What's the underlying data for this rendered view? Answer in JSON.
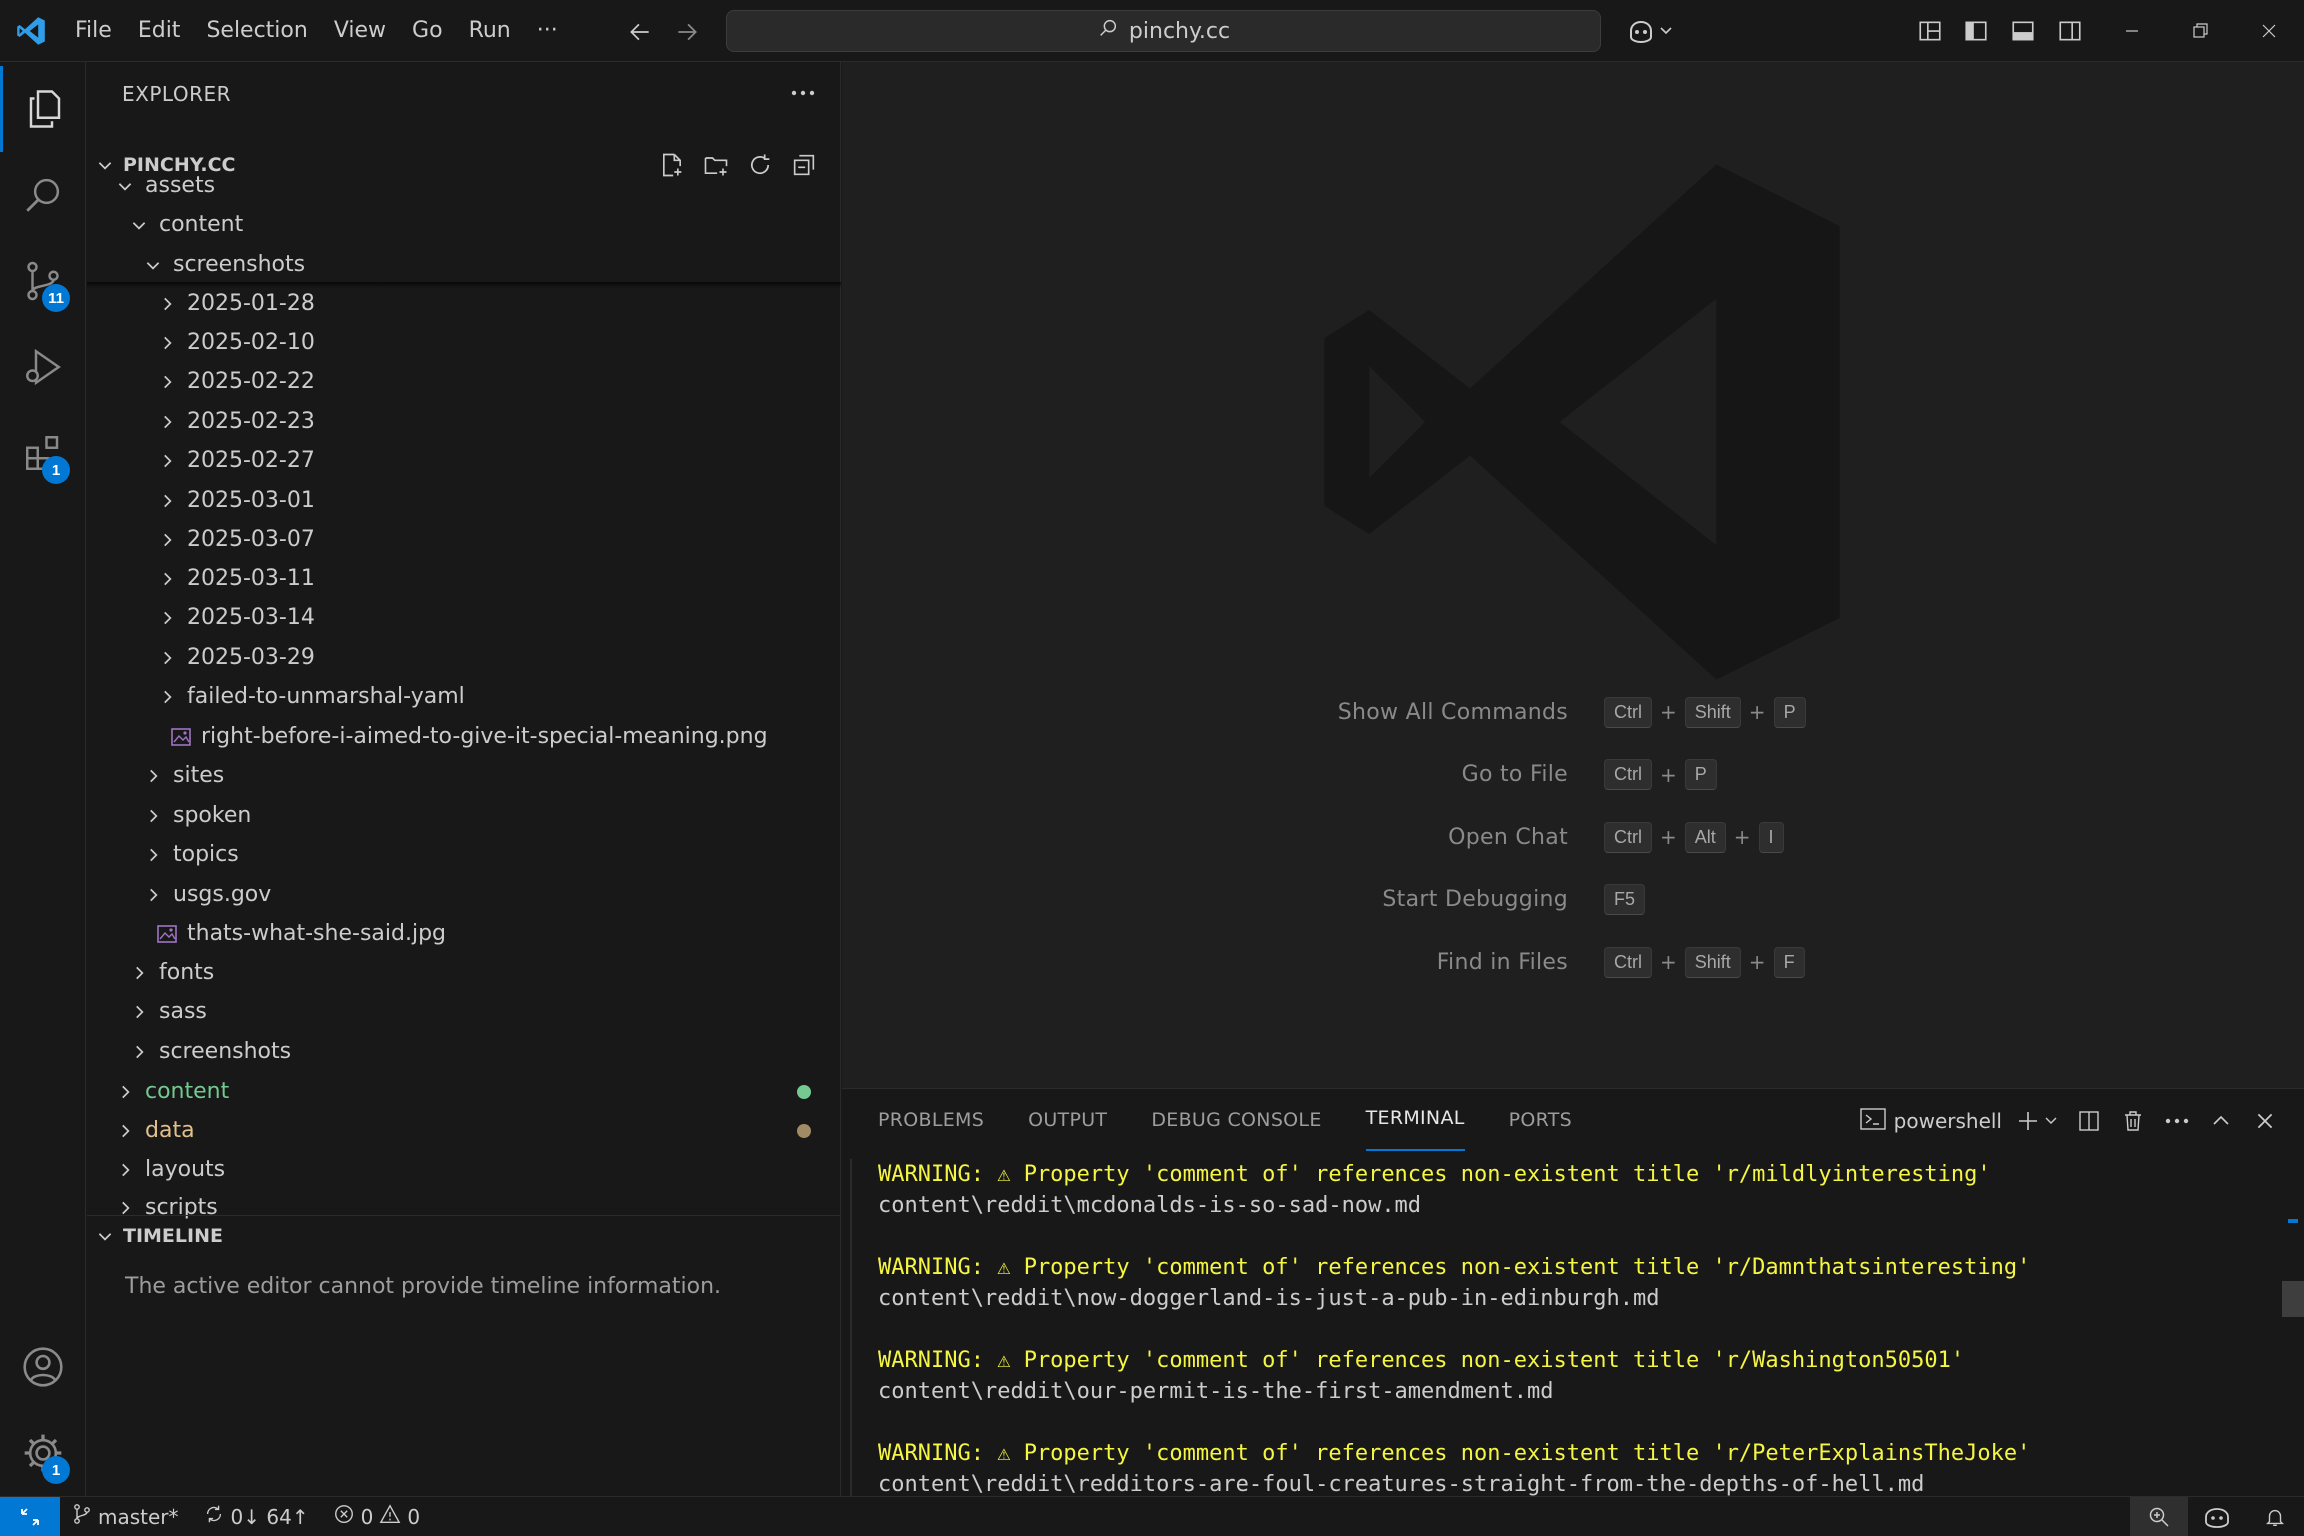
{
  "titlebar": {
    "menu": [
      "File",
      "Edit",
      "Selection",
      "View",
      "Go",
      "Run",
      "···"
    ],
    "search_text": "pinchy.cc"
  },
  "activity": {
    "scm_badge": "11",
    "extensions_badge": "1",
    "settings_badge": "1"
  },
  "explorer": {
    "title": "EXPLORER",
    "root": "PINCHY.CC",
    "rows": [
      {
        "label": "assets",
        "type": "folder-open",
        "depth": 1
      },
      {
        "label": "content",
        "type": "folder-open",
        "depth": 2
      },
      {
        "label": "screenshots",
        "type": "folder-open",
        "depth": 3
      },
      {
        "label": "2025-01-28",
        "type": "folder",
        "depth": 4
      },
      {
        "label": "2025-02-10",
        "type": "folder",
        "depth": 4
      },
      {
        "label": "2025-02-22",
        "type": "folder",
        "depth": 4
      },
      {
        "label": "2025-02-23",
        "type": "folder",
        "depth": 4
      },
      {
        "label": "2025-02-27",
        "type": "folder",
        "depth": 4
      },
      {
        "label": "2025-03-01",
        "type": "folder",
        "depth": 4
      },
      {
        "label": "2025-03-07",
        "type": "folder",
        "depth": 4
      },
      {
        "label": "2025-03-11",
        "type": "folder",
        "depth": 4
      },
      {
        "label": "2025-03-14",
        "type": "folder",
        "depth": 4
      },
      {
        "label": "2025-03-29",
        "type": "folder",
        "depth": 4
      },
      {
        "label": "failed-to-unmarshal-yaml",
        "type": "folder",
        "depth": 4
      },
      {
        "label": "right-before-i-aimed-to-give-it-special-meaning.png",
        "type": "image",
        "depth": 4
      },
      {
        "label": "sites",
        "type": "folder",
        "depth": 3
      },
      {
        "label": "spoken",
        "type": "folder",
        "depth": 3
      },
      {
        "label": "topics",
        "type": "folder",
        "depth": 3
      },
      {
        "label": "usgs.gov",
        "type": "folder",
        "depth": 3
      },
      {
        "label": "thats-what-she-said.jpg",
        "type": "image",
        "depth": 3
      },
      {
        "label": "fonts",
        "type": "folder",
        "depth": 2
      },
      {
        "label": "sass",
        "type": "folder",
        "depth": 2
      },
      {
        "label": "screenshots",
        "type": "folder",
        "depth": 2
      },
      {
        "label": "content",
        "type": "folder",
        "depth": 1,
        "color": "#73c991",
        "dot": "#73c991"
      },
      {
        "label": "data",
        "type": "folder",
        "depth": 1,
        "color": "#e2c08d",
        "dot": "#a28a64"
      },
      {
        "label": "layouts",
        "type": "folder",
        "depth": 1
      },
      {
        "label": "scripts",
        "type": "folder",
        "depth": 1
      }
    ]
  },
  "timeline": {
    "title": "TIMELINE",
    "message": "The active editor cannot provide timeline information."
  },
  "shortcuts": [
    {
      "label": "Show All Commands",
      "keys": [
        "Ctrl",
        "Shift",
        "P"
      ]
    },
    {
      "label": "Go to File",
      "keys": [
        "Ctrl",
        "P"
      ]
    },
    {
      "label": "Open Chat",
      "keys": [
        "Ctrl",
        "Alt",
        "I"
      ]
    },
    {
      "label": "Start Debugging",
      "keys": [
        "F5"
      ]
    },
    {
      "label": "Find in Files",
      "keys": [
        "Ctrl",
        "Shift",
        "F"
      ]
    }
  ],
  "panel": {
    "tabs": [
      "PROBLEMS",
      "OUTPUT",
      "DEBUG CONSOLE",
      "TERMINAL",
      "PORTS"
    ],
    "active_tab": "TERMINAL",
    "shell": "powershell",
    "terminal_lines": [
      {
        "kind": "warn",
        "text": "WARNING: ⚠ Property 'comment of' references non-existent title 'r/mildlyinteresting'"
      },
      {
        "kind": "path",
        "text": "content\\reddit\\mcdonalds-is-so-sad-now.md"
      },
      {
        "kind": "blank",
        "text": ""
      },
      {
        "kind": "warn",
        "text": "WARNING: ⚠ Property 'comment of' references non-existent title 'r/Damnthatsinteresting'"
      },
      {
        "kind": "path",
        "text": "content\\reddit\\now-doggerland-is-just-a-pub-in-edinburgh.md"
      },
      {
        "kind": "blank",
        "text": ""
      },
      {
        "kind": "warn",
        "text": "WARNING: ⚠ Property 'comment of' references non-existent title 'r/Washington50501'"
      },
      {
        "kind": "path",
        "text": "content\\reddit\\our-permit-is-the-first-amendment.md"
      },
      {
        "kind": "blank",
        "text": ""
      },
      {
        "kind": "warn",
        "text": "WARNING: ⚠ Property 'comment of' references non-existent title 'r/PeterExplainsTheJoke'"
      },
      {
        "kind": "path",
        "text": "content\\reddit\\redditors-are-foul-creatures-straight-from-the-depths-of-hell.md"
      }
    ]
  },
  "statusbar": {
    "branch": "master*",
    "sync": "0↓ 64↑",
    "errors": "0",
    "warnings": "0"
  },
  "colors": {
    "accent": "#0078d4",
    "warning_text": "#f5f543",
    "git_added": "#73c991",
    "git_modified": "#e2c08d",
    "image_icon": "#a074c4"
  }
}
